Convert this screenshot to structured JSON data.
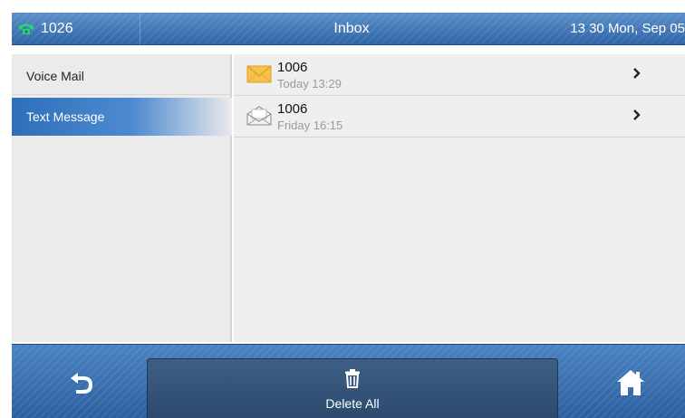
{
  "status_bar": {
    "account": "1026",
    "title": "Inbox",
    "datetime": "13 30 Mon, Sep 05"
  },
  "sidebar": {
    "items": [
      {
        "label": "Voice Mail",
        "selected": false
      },
      {
        "label": "Text Message",
        "selected": true
      }
    ]
  },
  "messages": [
    {
      "sender": "1006",
      "time": "Today 13:29",
      "status": "unread",
      "icon": "envelope-closed-icon"
    },
    {
      "sender": "1006",
      "time": "Friday 16:15",
      "status": "read",
      "icon": "envelope-open-icon"
    }
  ],
  "softkeys": {
    "back_icon": "back-arrow-icon",
    "delete_label": "Delete All",
    "delete_icon": "trash-icon",
    "home_icon": "home-icon"
  },
  "colors": {
    "bar_blue": "#2e64a6",
    "selected_blue": "#2f6fb8",
    "phone_green": "#2bd46a",
    "unread_envelope": "#f6c24a"
  }
}
